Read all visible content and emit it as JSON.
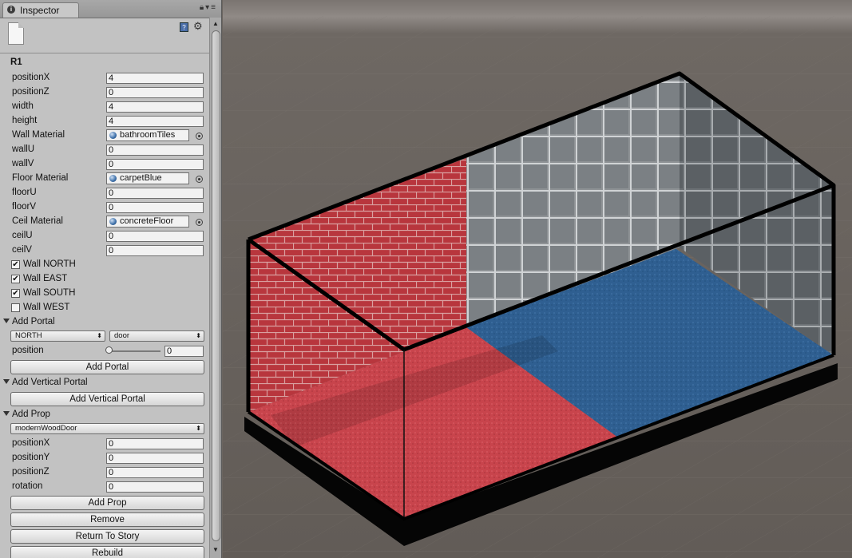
{
  "tab": {
    "title": "Inspector"
  },
  "object": {
    "name": "R1"
  },
  "fields": {
    "positionX": {
      "label": "positionX",
      "value": "4"
    },
    "positionZ": {
      "label": "positionZ",
      "value": "0"
    },
    "width": {
      "label": "width",
      "value": "4"
    },
    "height": {
      "label": "height",
      "value": "4"
    },
    "wallMaterial": {
      "label": "Wall Material",
      "value": "bathroomTiles"
    },
    "wallU": {
      "label": "wallU",
      "value": "0"
    },
    "wallV": {
      "label": "wallV",
      "value": "0"
    },
    "floorMaterial": {
      "label": "Floor Material",
      "value": "carpetBlue"
    },
    "floorU": {
      "label": "floorU",
      "value": "0"
    },
    "floorV": {
      "label": "floorV",
      "value": "0"
    },
    "ceilMaterial": {
      "label": "Ceil Material",
      "value": "concreteFloor"
    },
    "ceilU": {
      "label": "ceilU",
      "value": "0"
    },
    "ceilV": {
      "label": "ceilV",
      "value": "0"
    }
  },
  "walls": {
    "north": {
      "label": "Wall NORTH",
      "checked": true
    },
    "east": {
      "label": "Wall EAST",
      "checked": true
    },
    "south": {
      "label": "Wall SOUTH",
      "checked": true
    },
    "west": {
      "label": "Wall WEST",
      "checked": false
    }
  },
  "portal": {
    "section": "Add Portal",
    "direction": "NORTH",
    "type": "door",
    "position_label": "position",
    "position_value": "0",
    "button": "Add Portal"
  },
  "vertical_portal": {
    "section": "Add Vertical Portal",
    "button": "Add Vertical Portal"
  },
  "prop": {
    "section": "Add Prop",
    "selected": "modernWoodDoor",
    "positionX": {
      "label": "positionX",
      "value": "0"
    },
    "positionY": {
      "label": "positionY",
      "value": "0"
    },
    "positionZ": {
      "label": "positionZ",
      "value": "0"
    },
    "rotation": {
      "label": "rotation",
      "value": "0"
    },
    "button": "Add Prop"
  },
  "actions": {
    "remove": "Remove",
    "return": "Return To Story",
    "rebuild": "Rebuild"
  },
  "icons": [
    "info-icon",
    "lock-icon",
    "menu-icon",
    "file-icon",
    "help-icon",
    "gear-icon"
  ],
  "colors": {
    "panel": "#c2c2c2",
    "scene_bg": "#6b6560",
    "brick": "#b8363d",
    "tile": "#8f9396",
    "carpet_blue": "#2f5f91",
    "carpet_red": "#c8444c"
  }
}
